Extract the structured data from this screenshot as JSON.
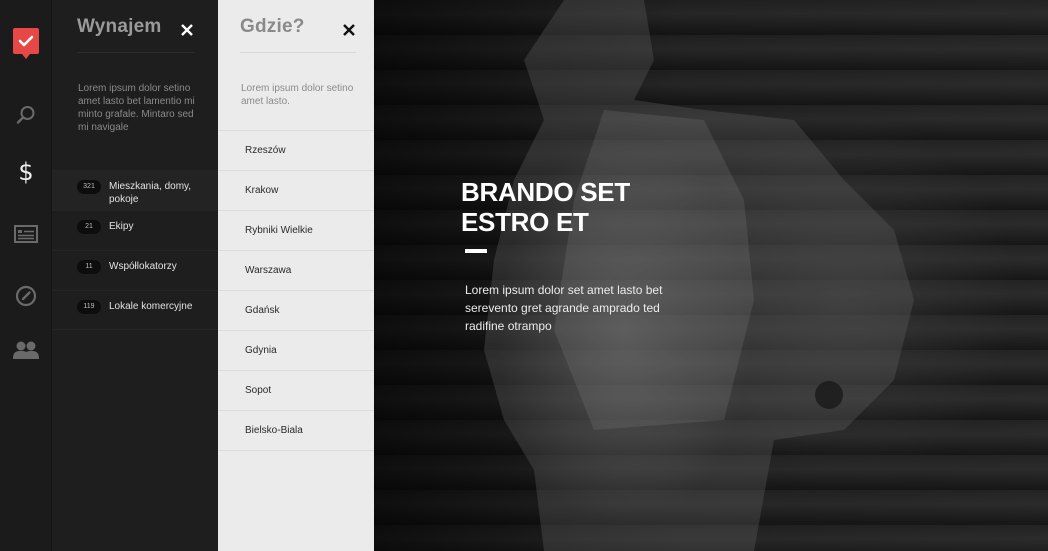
{
  "brand": {
    "accent": "#e64848",
    "logo_icon": "check-icon"
  },
  "rail": {
    "items": [
      {
        "name": "search",
        "icon": "search-icon"
      },
      {
        "name": "price",
        "icon": "dollar-icon",
        "active": true
      },
      {
        "name": "listings",
        "icon": "list-card-icon"
      },
      {
        "name": "stats",
        "icon": "gauge-icon"
      },
      {
        "name": "users",
        "icon": "users-icon"
      }
    ]
  },
  "panel1": {
    "title": "Wynajem",
    "description": "Lorem ipsum dolor setino amet lasto bet lamentio mi minto grafale. Mintaro sed mi navigale",
    "categories": [
      {
        "count": "321",
        "label": "Mieszkania, domy, pokoje"
      },
      {
        "count": "21",
        "label": "Ekipy"
      },
      {
        "count": "11",
        "label": "Współlokatorzy"
      },
      {
        "count": "119",
        "label": "Lokale komercyjne"
      }
    ]
  },
  "panel2": {
    "title": "Gdzie?",
    "description": "Lorem ipsum dolor setino amet lasto.",
    "cities": [
      "Rzeszów",
      "Krakow",
      "Rybniki Wielkie",
      "Warszawa",
      "Gdańsk",
      "Gdynia",
      "Sopot",
      "Bielsko-Biala"
    ]
  },
  "hero": {
    "heading_line1": "BRANDO SET",
    "heading_line2": "ESTRO ET",
    "text": "Lorem ipsum dolor set amet lasto bet serevento gret agrande amprado ted radifine otrampo"
  }
}
